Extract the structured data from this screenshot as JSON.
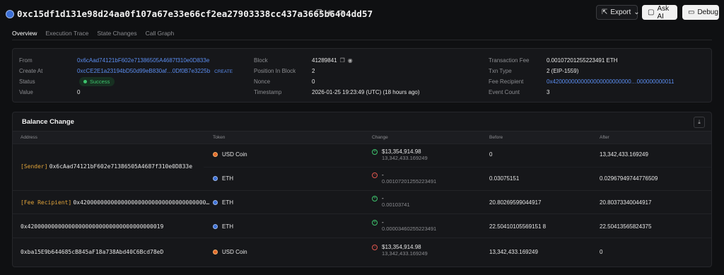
{
  "header": {
    "tx_hash": "0xc15df1d131e98d24aa0f107a67e33e66cf2ea27903338cc437a3665b6404dd57",
    "export_label": "Export",
    "ask_label": "Ask AI",
    "debug_label": "Debug"
  },
  "tabs": [
    "Overview",
    "Execution Trace",
    "State Changes",
    "Call Graph"
  ],
  "details": {
    "from_label": "From",
    "from_value": "0x6cAad74121bF602e71386505A4687f310e0D833e",
    "create_at_label": "Create At",
    "create_at_value": "0xcCE2E1a23194bD50d99eB830af…0Df0B7e3225b",
    "create_tag": "CREATE",
    "status_label": "Status",
    "status_value": "Success",
    "value_label": "Value",
    "value_value": "0",
    "block_label": "Block",
    "block_value": "41289841",
    "position_label": "Position In Block",
    "position_value": "2",
    "nonce_label": "Nonce",
    "nonce_value": "0",
    "timestamp_label": "Timestamp",
    "timestamp_value": "2026-01-25 19:23:49 (UTC) (18 hours ago)",
    "fee_label": "Transaction Fee",
    "fee_value": "0.00107201255223491 ETH",
    "txtype_label": "Txn Type",
    "txtype_value": "2 (EIP-1559)",
    "recipient_label": "Fee Recipient",
    "recipient_value": "0x4200000000000000000000000…000000000011",
    "events_label": "Event Count",
    "events_value": "3"
  },
  "balance": {
    "title": "Balance Change",
    "columns": [
      "Address",
      "Token",
      "Change",
      "Before",
      "After"
    ],
    "rows": [
      {
        "address_tag": "[Sender]",
        "address": "0x6cAad74121bF602e71386505A4687f310e0D833e",
        "token": "USD Coin",
        "change_main": "$13,354,914.98",
        "change_sub": "13,342,433.169249",
        "before": "0",
        "after": "13,342,433.169249"
      },
      {
        "token": "ETH",
        "change_main": "-",
        "change_sub": "0.00107201255223491",
        "before": "0.03075151",
        "after": "0.02967949744776509"
      },
      {
        "address_tag": "[Fee Recipient]",
        "address": "0x4200000000000000000000000000000000000…",
        "token": "ETH",
        "change_main": "-",
        "change_sub": "0.00103741",
        "before": "20.80269599044917",
        "after": "20.80373340044917"
      },
      {
        "address": "0x4200000000000000000000000000000000000019",
        "token": "ETH",
        "change_main": "-",
        "change_sub": "0.00003460255223491",
        "before": "22.50410105569151 8",
        "after": "22.50413565824375"
      },
      {
        "address": "0xba15E9b644685cB845aF18a738Abd40C6Bcd78eD",
        "token": "USD Coin",
        "change_main": "$13,354,914.98",
        "change_sub": "13,342,433.169249",
        "before": "13,342,433.169249",
        "after": "0"
      }
    ]
  }
}
